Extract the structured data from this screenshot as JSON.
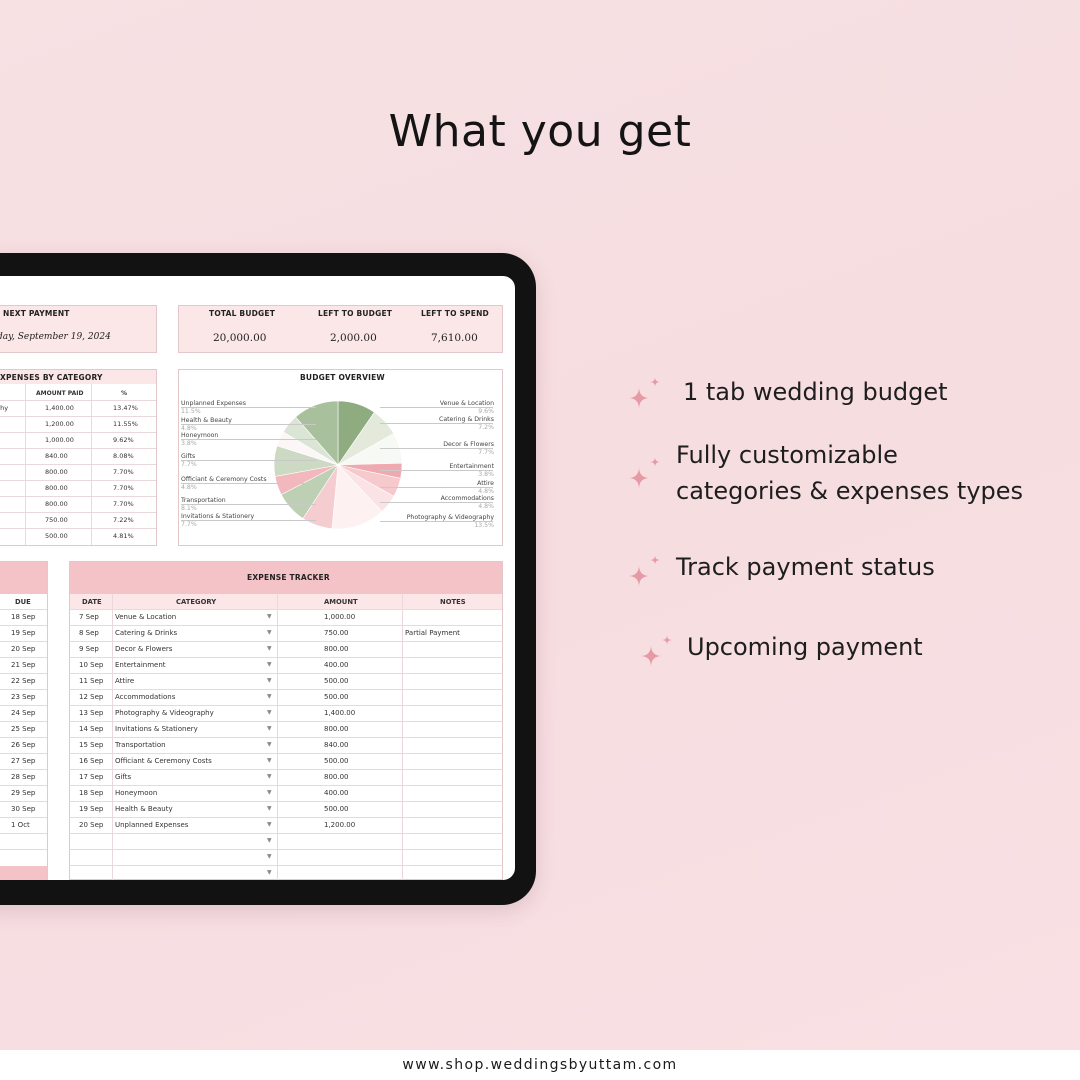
{
  "title": "What you get",
  "footer_url": "www.shop.weddingsbyuttam.com",
  "colors": {
    "accent_pink": "#f4c3c7",
    "light_pink": "#fbe6e8",
    "sage": "#9db88f"
  },
  "next_payment": {
    "label": "NEXT PAYMENT",
    "value": "day, September 19, 2024"
  },
  "summary": {
    "total_budget_label": "TOTAL BUDGET",
    "total_budget": "20,000.00",
    "left_to_budget_label": "LEFT TO BUDGET",
    "left_to_budget": "2,000.00",
    "left_to_spend_label": "LEFT TO SPEND",
    "left_to_spend": "7,610.00"
  },
  "expenses_by_category": {
    "title": "XPENSES BY CATEGORY",
    "col_amount": "AMOUNT PAID",
    "col_pct": "%",
    "first_label": "phy",
    "rows": [
      {
        "amount": "1,400.00",
        "pct": "13.47%"
      },
      {
        "amount": "1,200.00",
        "pct": "11.55%"
      },
      {
        "amount": "1,000.00",
        "pct": "9.62%"
      },
      {
        "amount": "840.00",
        "pct": "8.08%"
      },
      {
        "amount": "800.00",
        "pct": "7.70%"
      },
      {
        "amount": "800.00",
        "pct": "7.70%"
      },
      {
        "amount": "800.00",
        "pct": "7.70%"
      },
      {
        "amount": "750.00",
        "pct": "7.22%"
      },
      {
        "amount": "500.00",
        "pct": "4.81%"
      }
    ]
  },
  "budget_overview": {
    "title": "BUDGET OVERVIEW",
    "left_legend": [
      {
        "name": "Unplanned Expenses",
        "pct": "11.5%"
      },
      {
        "name": "Health & Beauty",
        "pct": "4.8%"
      },
      {
        "name": "Honeymoon",
        "pct": "3.8%"
      },
      {
        "name": "Gifts",
        "pct": "7.7%"
      },
      {
        "name": "Officiant & Ceremony Costs",
        "pct": "4.8%"
      },
      {
        "name": "Transportation",
        "pct": "8.1%"
      },
      {
        "name": "Invitations & Stationery",
        "pct": "7.7%"
      }
    ],
    "right_legend": [
      {
        "name": "Venue & Location",
        "pct": "9.6%"
      },
      {
        "name": "Catering & Drinks",
        "pct": "7.2%"
      },
      {
        "name": "Decor & Flowers",
        "pct": "7.7%"
      },
      {
        "name": "Entertainment",
        "pct": "3.8%"
      },
      {
        "name": "Attire",
        "pct": "4.8%"
      },
      {
        "name": "Accommodations",
        "pct": "4.8%"
      },
      {
        "name": "Photography & Videography",
        "pct": "13.5%"
      }
    ],
    "slices": [
      {
        "value": 9.6,
        "color": "#8fab80"
      },
      {
        "value": 7.2,
        "color": "#e3eadc"
      },
      {
        "value": 7.7,
        "color": "#f7f9f4"
      },
      {
        "value": 3.8,
        "color": "#f1a9b0"
      },
      {
        "value": 4.8,
        "color": "#f6c9cd"
      },
      {
        "value": 4.8,
        "color": "#fbe3e5"
      },
      {
        "value": 13.5,
        "color": "#fdf1f2"
      },
      {
        "value": 7.7,
        "color": "#f5ccd0"
      },
      {
        "value": 8.1,
        "color": "#bdd0b3"
      },
      {
        "value": 4.8,
        "color": "#f2b8be"
      },
      {
        "value": 7.7,
        "color": "#ccdac4"
      },
      {
        "value": 3.8,
        "color": "#fdf6f6"
      },
      {
        "value": 4.8,
        "color": "#dbe5d5"
      },
      {
        "value": 11.5,
        "color": "#a9c09d"
      }
    ]
  },
  "due_column": {
    "header": "DUE",
    "rows": [
      "18 Sep",
      "19 Sep",
      "20 Sep",
      "21 Sep",
      "22 Sep",
      "23 Sep",
      "24 Sep",
      "25 Sep",
      "26 Sep",
      "27 Sep",
      "28 Sep",
      "29 Sep",
      "30 Sep",
      "1 Oct"
    ]
  },
  "expense_tracker": {
    "title": "EXPENSE TRACKER",
    "col_date": "DATE",
    "col_category": "CATEGORY",
    "col_amount": "AMOUNT",
    "col_notes": "NOTES",
    "rows": [
      {
        "date": "7 Sep",
        "category": "Venue & Location",
        "amount": "1,000.00",
        "notes": ""
      },
      {
        "date": "8 Sep",
        "category": "Catering & Drinks",
        "amount": "750.00",
        "notes": "Partial Payment"
      },
      {
        "date": "9 Sep",
        "category": "Decor & Flowers",
        "amount": "800.00",
        "notes": ""
      },
      {
        "date": "10 Sep",
        "category": "Entertainment",
        "amount": "400.00",
        "notes": ""
      },
      {
        "date": "11 Sep",
        "category": "Attire",
        "amount": "500.00",
        "notes": ""
      },
      {
        "date": "12 Sep",
        "category": "Accommodations",
        "amount": "500.00",
        "notes": ""
      },
      {
        "date": "13 Sep",
        "category": "Photography & Videography",
        "amount": "1,400.00",
        "notes": ""
      },
      {
        "date": "14 Sep",
        "category": "Invitations & Stationery",
        "amount": "800.00",
        "notes": ""
      },
      {
        "date": "15 Sep",
        "category": "Transportation",
        "amount": "840.00",
        "notes": ""
      },
      {
        "date": "16 Sep",
        "category": "Officiant & Ceremony Costs",
        "amount": "500.00",
        "notes": ""
      },
      {
        "date": "17 Sep",
        "category": "Gifts",
        "amount": "800.00",
        "notes": ""
      },
      {
        "date": "18 Sep",
        "category": "Honeymoon",
        "amount": "400.00",
        "notes": ""
      },
      {
        "date": "19 Sep",
        "category": "Health & Beauty",
        "amount": "500.00",
        "notes": ""
      },
      {
        "date": "20 Sep",
        "category": "Unplanned Expenses",
        "amount": "1,200.00",
        "notes": ""
      }
    ],
    "dropdown_icon": "chevron-down-icon"
  },
  "features": [
    {
      "line1": "1 tab wedding budget",
      "line2": ""
    },
    {
      "line1": "Fully customizable",
      "line2": "categories & expenses types"
    },
    {
      "line1": "Track payment status",
      "line2": ""
    },
    {
      "line1": "Upcoming payment",
      "line2": ""
    }
  ]
}
